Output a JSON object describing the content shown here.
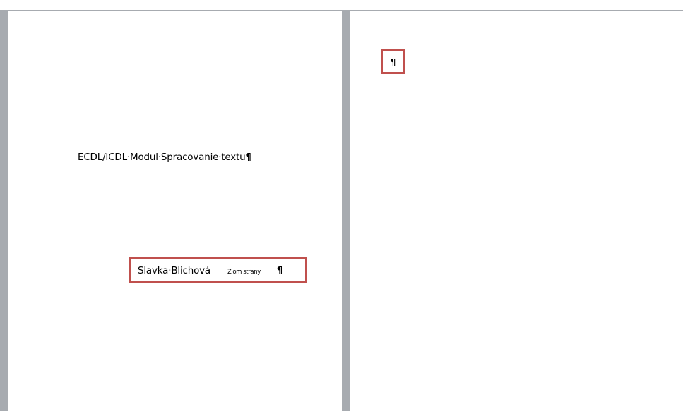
{
  "document": {
    "left_page": {
      "title_text": "ECDL/ICDL·Modul·Spracovanie·textu",
      "title_mark": "¶",
      "author_text": "Slavka·Blichová",
      "page_break_label": "Zlom strany",
      "author_mark": "¶"
    },
    "right_page": {
      "paragraph_mark": "¶"
    }
  },
  "colors": {
    "highlight_border": "#c0504d",
    "workspace_background": "#a7abb0",
    "page_background": "#ffffff"
  }
}
